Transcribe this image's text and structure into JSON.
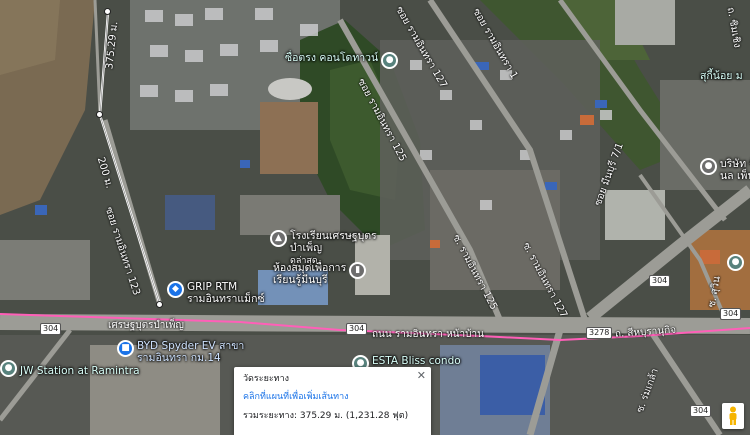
{
  "map": {
    "type": "satellite",
    "colors": {
      "measure_line": "#ff5fb8",
      "water": "#e98cc9"
    }
  },
  "pois": [
    {
      "name": "ซื่อตรง คอนโดทาวน์",
      "color": "teal",
      "icon": "pin-icon"
    },
    {
      "name": "โรงเรียนเศรษฐบุตร",
      "sub": "บำเพ็ญ",
      "sub2": "ดูล่าสุด",
      "color": "gray",
      "icon": "school-icon"
    },
    {
      "name": "ห้องสมุดเพื่อการ",
      "sub": "เรียนรู้มีนบุรี",
      "color": "gray",
      "icon": "library-icon"
    },
    {
      "name": "GRIP RTM",
      "sub": "รามอินทราแม็กซ์",
      "color": "blue",
      "icon": "shopping-icon"
    },
    {
      "name": "BYD Spyder EV สาขา",
      "sub": "รามอินทรา กม.14",
      "color": "blue",
      "icon": "car-icon"
    },
    {
      "name": "JW Station at Ramintra",
      "color": "teal",
      "icon": "pin-icon"
    },
    {
      "name": "ESTA Bliss condo",
      "color": "teal",
      "icon": "pin-icon"
    },
    {
      "name": "สุกี้น้อย ม",
      "color": "teal",
      "icon": "pin-icon"
    },
    {
      "name": "บริษัท ซี",
      "sub": "นล เพ็น",
      "color": "gray",
      "icon": "pin-icon"
    }
  ],
  "roads": [
    {
      "name": "ซอย รามอินทรา 127"
    },
    {
      "name": "ซอย รามอินทรา 125"
    },
    {
      "name": "ซ. รามอินทรา 125"
    },
    {
      "name": "ซ. รามอินทรา 127"
    },
    {
      "name": "ซอย รามอินทรา 123"
    },
    {
      "name": "ซอย รามอินทรา 1"
    },
    {
      "name": "ถนน รามอินทรา หน้าบ้าน"
    },
    {
      "name": "ถ. สีหบุรานุกิจ"
    },
    {
      "name": "เศรษฐบุตรบำเพ็ญ"
    },
    {
      "name": "ซอย มีนบุรี 7/1"
    },
    {
      "name": "ซ. สุวิน"
    },
    {
      "name": "ซ. ร่มเกล้า"
    },
    {
      "name": "ถ. ซิมเชิง"
    }
  ],
  "route_shields": [
    "304",
    "304",
    "304",
    "304",
    "3278",
    "304"
  ],
  "measure": {
    "labels": [
      "375.29 ม.",
      "200 ม."
    ],
    "panel": {
      "title": "วัดระยะทาง",
      "hint": "คลิกที่แผนที่เพื่อเพิ่มเส้นทาง",
      "distance_label": "รวมระยะทาง:",
      "distance_value": "375.29 ม. (1,231.28 ฟุต)"
    }
  },
  "icons": {
    "close": "close-icon",
    "pegman": "pegman-icon"
  }
}
